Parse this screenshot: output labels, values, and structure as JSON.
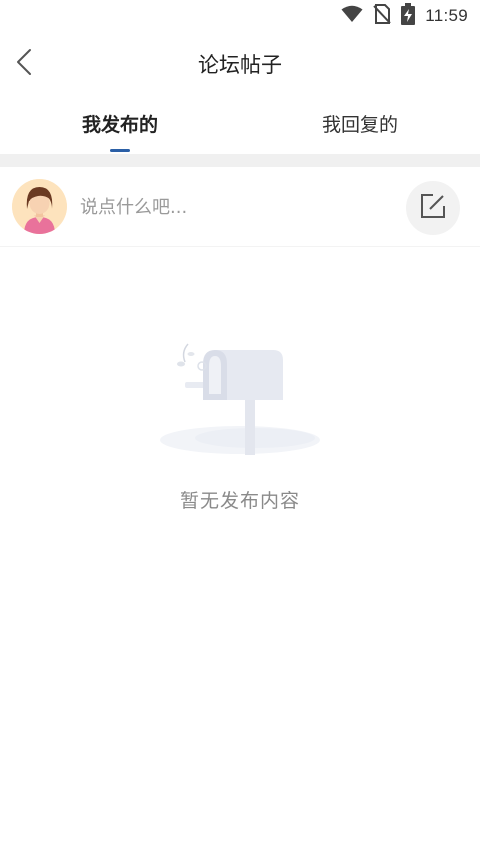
{
  "status_bar": {
    "time": "11:59",
    "icons": [
      "wifi-icon",
      "no-sim-icon",
      "battery-charging-icon"
    ]
  },
  "nav": {
    "title": "论坛帖子",
    "back_icon": "chevron-left-icon"
  },
  "tabs": [
    {
      "label": "我发布的",
      "active": true
    },
    {
      "label": "我回复的",
      "active": false
    }
  ],
  "compose": {
    "placeholder": "说点什么吧...",
    "edit_icon": "edit-icon",
    "avatar": "avatar-female"
  },
  "empty_state": {
    "illustration": "mailbox-illustration",
    "message": "暂无发布内容"
  },
  "colors": {
    "accent": "#2b5fa6",
    "band": "#f0f0f0",
    "muted_text": "#8a8a8a"
  }
}
